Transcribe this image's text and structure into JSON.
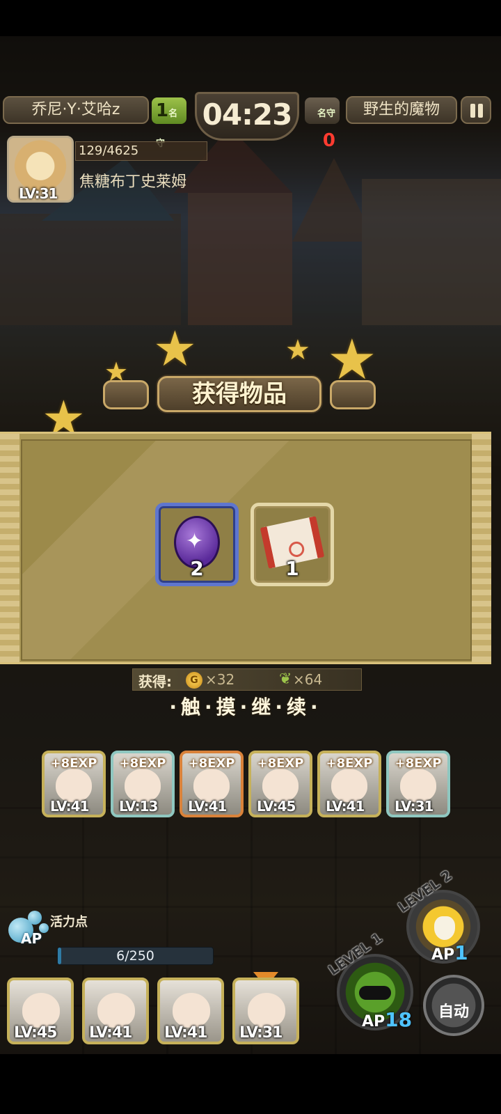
{
  "hud": {
    "player_name": "乔尼·Y·艾哈z",
    "player_rank": "1",
    "rank_unit": "名守",
    "timer": "04:23",
    "enemy_rank": "0",
    "enemy_side_name": "野生的魔物"
  },
  "enemy": {
    "level": "LV:31",
    "hp": "129/4625",
    "name": "焦糖布丁史莱姆"
  },
  "reward": {
    "title": "获得物品",
    "items": [
      {
        "icon": "purple-rabbit-coin-icon",
        "count": "2",
        "frame_color": "#5f76ce"
      },
      {
        "icon": "red-scroll-icon",
        "count": "1",
        "frame_color": "#e4d7a8"
      }
    ],
    "gain_label": "获得:",
    "gold_symbol": "G",
    "gold": "×32",
    "feather": "×64",
    "continue_text": "·触·摸·继·续·"
  },
  "party": [
    {
      "exp": "+8EXP",
      "level": "LV:41",
      "frame": "#c6b15a"
    },
    {
      "exp": "+8EXP",
      "level": "LV:13",
      "frame": "#8fc7c0"
    },
    {
      "exp": "+8EXP",
      "level": "LV:41",
      "frame": "#d9823a"
    },
    {
      "exp": "+8EXP",
      "level": "LV:45",
      "frame": "#c6b15a"
    },
    {
      "exp": "+8EXP",
      "level": "LV:41",
      "frame": "#c6b15a"
    },
    {
      "exp": "+8EXP",
      "level": "LV:31",
      "frame": "#8fc7c0"
    }
  ],
  "ap": {
    "title": "活力点",
    "label": "AP",
    "value": "6/250",
    "fraction": 0.024
  },
  "units": [
    {
      "level": "LV:45"
    },
    {
      "level": "LV:41"
    },
    {
      "level": "LV:41"
    },
    {
      "level": "LV:31"
    }
  ],
  "skills": {
    "level1": "LEVEL 1",
    "level1_cost_prefix": "AP",
    "level1_cost": "18",
    "level2": "LEVEL 2",
    "level2_cost_prefix": "AP",
    "level2_cost": "1",
    "auto_label": "自动"
  }
}
